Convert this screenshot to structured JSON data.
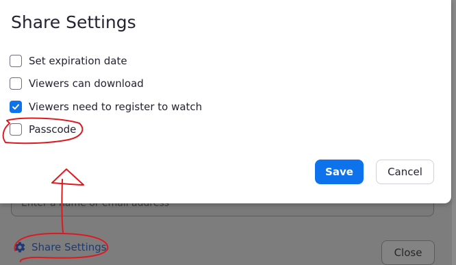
{
  "dialog": {
    "title": "Share Settings",
    "options": [
      {
        "label": "Set expiration date",
        "checked": false
      },
      {
        "label": "Viewers can download",
        "checked": false
      },
      {
        "label": "Viewers need to register to watch",
        "checked": true
      },
      {
        "label": "Passcode",
        "checked": false
      }
    ],
    "save_label": "Save",
    "cancel_label": "Cancel"
  },
  "background": {
    "input_placeholder": "Enter a name or email address",
    "share_settings_label": "Share Settings",
    "close_label": "Close"
  },
  "colors": {
    "accent": "#0e72ed",
    "annotation": "#e0181e"
  }
}
